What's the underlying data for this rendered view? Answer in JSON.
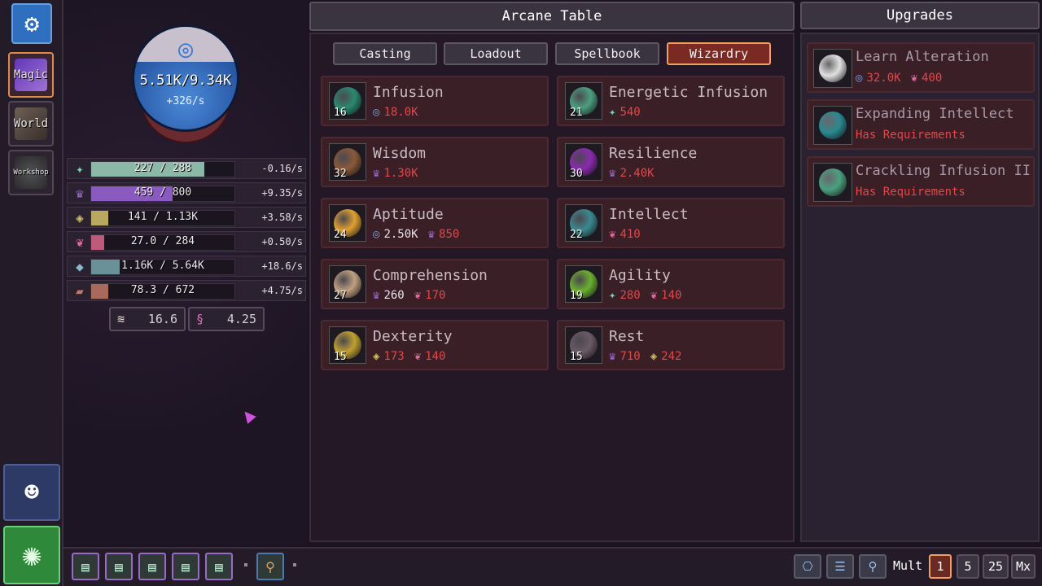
{
  "nav": {
    "items": [
      {
        "label": "Magic",
        "active": true
      },
      {
        "label": "World",
        "active": false
      },
      {
        "label": "Workshop",
        "active": false
      }
    ]
  },
  "orb": {
    "value": "5.51K/9.34K",
    "rate": "+326/s"
  },
  "resources": [
    {
      "icon": "spark-icon",
      "value": "227 / 288",
      "rate": "-0.16/s",
      "fill": 0.79,
      "color": "#8cb8a8"
    },
    {
      "icon": "lotus-icon",
      "value": "459 / 800",
      "rate": "+9.35/s",
      "fill": 0.57,
      "color": "#8a5ac0"
    },
    {
      "icon": "rune-icon",
      "value": "141 / 1.13K",
      "rate": "+3.58/s",
      "fill": 0.12,
      "color": "#b8a860"
    },
    {
      "icon": "heart-icon",
      "value": "27.0 / 284",
      "rate": "+0.50/s",
      "fill": 0.09,
      "color": "#c05a7a"
    },
    {
      "icon": "cube-icon",
      "value": "1.16K / 5.64K",
      "rate": "+18.6/s",
      "fill": 0.2,
      "color": "#6a9098"
    },
    {
      "icon": "scroll-icon",
      "value": "78.3 / 672",
      "rate": "+4.75/s",
      "fill": 0.12,
      "color": "#a86a5a"
    }
  ],
  "mini_stats": [
    {
      "icon": "page-icon",
      "value": "16.6"
    },
    {
      "icon": "scroll-pink-icon",
      "value": "4.25"
    }
  ],
  "main": {
    "title": "Arcane Table",
    "tabs": [
      {
        "label": "Casting",
        "active": false
      },
      {
        "label": "Loadout",
        "active": false
      },
      {
        "label": "Spellbook",
        "active": false
      },
      {
        "label": "Wizardry",
        "active": true
      }
    ],
    "cards": [
      {
        "name": "Infusion",
        "level": "16",
        "orb": "#2a8a70",
        "costs": [
          {
            "icon": "mana-icon",
            "value": "18.0K",
            "ok": false
          }
        ]
      },
      {
        "name": "Energetic Infusion",
        "level": "21",
        "orb": "#4aa080",
        "costs": [
          {
            "icon": "spark-icon",
            "value": "540",
            "ok": false
          }
        ]
      },
      {
        "name": "Wisdom",
        "level": "32",
        "orb": "#8a5a3a",
        "costs": [
          {
            "icon": "lotus-icon",
            "value": "1.30K",
            "ok": false
          }
        ]
      },
      {
        "name": "Resilience",
        "level": "30",
        "orb": "#8a2ab0",
        "costs": [
          {
            "icon": "lotus-icon",
            "value": "2.40K",
            "ok": false
          }
        ]
      },
      {
        "name": "Aptitude",
        "level": "24",
        "orb": "#e0a030",
        "costs": [
          {
            "icon": "mana-icon",
            "value": "2.50K",
            "ok": true
          },
          {
            "icon": "lotus-icon",
            "value": "850",
            "ok": false
          }
        ]
      },
      {
        "name": "Intellect",
        "level": "22",
        "orb": "#3a8a90",
        "costs": [
          {
            "icon": "heart-icon",
            "value": "410",
            "ok": false
          }
        ]
      },
      {
        "name": "Comprehension",
        "level": "27",
        "orb": "#c0a080",
        "costs": [
          {
            "icon": "lotus-icon",
            "value": "260",
            "ok": true
          },
          {
            "icon": "heart-icon",
            "value": "170",
            "ok": false
          }
        ]
      },
      {
        "name": "Agility",
        "level": "19",
        "orb": "#6ab030",
        "costs": [
          {
            "icon": "spark-icon",
            "value": "280",
            "ok": false
          },
          {
            "icon": "heart-icon",
            "value": "140",
            "ok": false
          }
        ]
      },
      {
        "name": "Dexterity",
        "level": "15",
        "orb": "#c0a030",
        "costs": [
          {
            "icon": "rune-icon",
            "value": "173",
            "ok": false
          },
          {
            "icon": "heart-icon",
            "value": "140",
            "ok": false
          }
        ]
      },
      {
        "name": "Rest",
        "level": "15",
        "orb": "#6a5a66",
        "costs": [
          {
            "icon": "lotus-icon",
            "value": "710",
            "ok": false
          },
          {
            "icon": "rune-icon",
            "value": "242",
            "ok": false
          }
        ]
      }
    ]
  },
  "upgrades": {
    "title": "Upgrades",
    "items": [
      {
        "name": "Learn Alteration",
        "costs": [
          {
            "icon": "mana-icon",
            "value": "32.0K"
          },
          {
            "icon": "heart-icon",
            "value": "400"
          }
        ],
        "note": ""
      },
      {
        "name": "Expanding Intellect",
        "costs": [],
        "note": "Has Requirements"
      },
      {
        "name": "Crackling Infusion II",
        "costs": [],
        "note": "Has Requirements"
      }
    ]
  },
  "bottom": {
    "mult_label": "Mult",
    "mults": [
      {
        "label": "1",
        "active": true
      },
      {
        "label": "5",
        "active": false
      },
      {
        "label": "25",
        "active": false
      },
      {
        "label": "Mx",
        "active": false
      }
    ]
  }
}
